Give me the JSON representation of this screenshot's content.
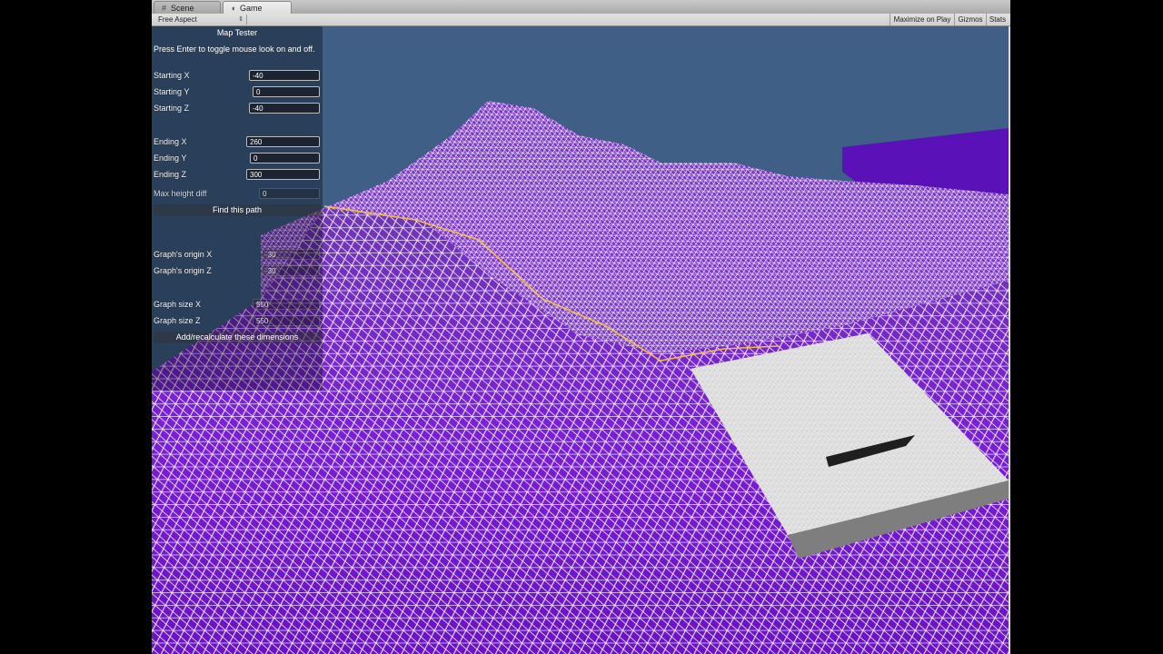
{
  "tabs": [
    {
      "label": "Scene",
      "icon": "grid-icon"
    },
    {
      "label": "Game",
      "icon": "pacman-icon"
    }
  ],
  "toolbar": {
    "aspect": "Free Aspect",
    "maximize": "Maximize on Play",
    "gizmos": "Gizmos",
    "stats": "Stats"
  },
  "gui": {
    "title": "Map Tester",
    "help": "Press Enter to toggle mouse look on and off.",
    "starting_x": {
      "label": "Starting X",
      "value": "-40"
    },
    "starting_y": {
      "label": "Starting Y",
      "value": "0"
    },
    "starting_z": {
      "label": "Starting Z",
      "value": "-40"
    },
    "ending_x": {
      "label": "Ending X",
      "value": "260"
    },
    "ending_y": {
      "label": "Ending Y",
      "value": "0"
    },
    "ending_z": {
      "label": "Ending Z",
      "value": "300"
    },
    "max_height": {
      "label": "Max height diff",
      "value": "0"
    },
    "find_path": "Find this path",
    "origin_x": {
      "label": "Graph's origin X",
      "value": "-30"
    },
    "origin_z": {
      "label": "Graph's origin Z",
      "value": "-30"
    },
    "size_x": {
      "label": "Graph size X",
      "value": "550"
    },
    "size_z": {
      "label": "Graph size Z",
      "value": "550"
    },
    "recalc": "Add/recalculate these dimensions"
  },
  "colors": {
    "sky": "#3f5f86",
    "terrain": "#7a1fd6",
    "wire": "#ffffff",
    "path": "#f2c040",
    "platform": "#d9d9d9"
  }
}
